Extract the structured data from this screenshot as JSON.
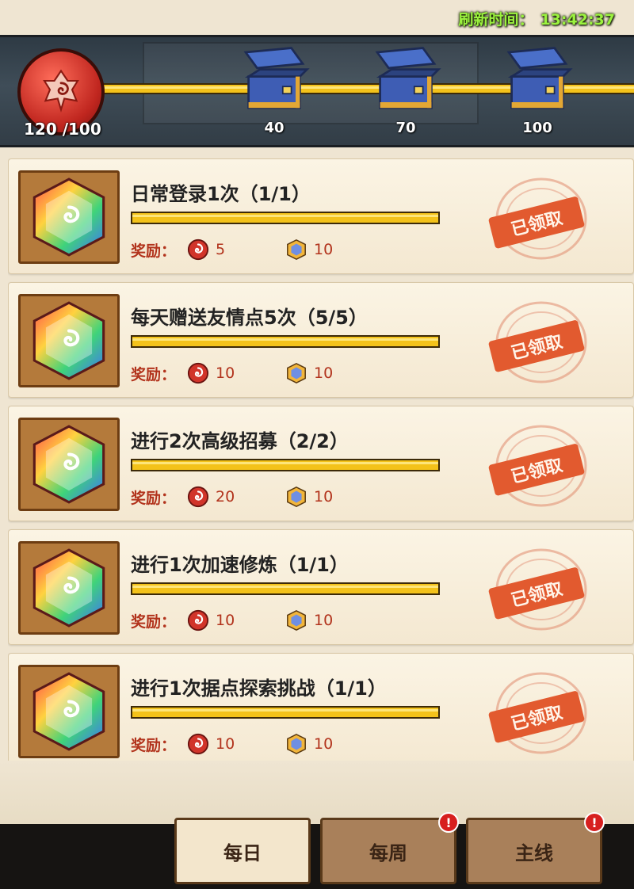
{
  "header": {
    "refresh_label": "刷新时间：",
    "refresh_time": "13:42:37"
  },
  "progress": {
    "score_text": "120 /100",
    "current": 120,
    "max": 100,
    "milestones": [
      {
        "label": "40",
        "value": 40,
        "icon": "treasure-chest-icon"
      },
      {
        "label": "70",
        "value": 70,
        "icon": "treasure-chest-icon"
      },
      {
        "label": "100",
        "value": 100,
        "icon": "treasure-chest-icon"
      }
    ],
    "bar_color": "#f3c21a"
  },
  "tasks": [
    {
      "title": "日常登录1次（1/1）",
      "progress": 1.0,
      "reward_label": "奖励：",
      "reward_1_value": "5",
      "reward_2_value": "10",
      "status": "已领取"
    },
    {
      "title": "每天赠送友情点5次（5/5）",
      "progress": 1.0,
      "reward_label": "奖励：",
      "reward_1_value": "10",
      "reward_2_value": "10",
      "status": "已领取"
    },
    {
      "title": "进行2次高级招募（2/2）",
      "progress": 1.0,
      "reward_label": "奖励：",
      "reward_1_value": "20",
      "reward_2_value": "10",
      "status": "已领取"
    },
    {
      "title": "进行1次加速修炼（1/1）",
      "progress": 1.0,
      "reward_label": "奖励：",
      "reward_1_value": "10",
      "reward_2_value": "10",
      "status": "已领取"
    },
    {
      "title": "进行1次据点探索挑战（1/1）",
      "progress": 1.0,
      "reward_label": "奖励：",
      "reward_1_value": "10",
      "reward_2_value": "10",
      "status": "已领取"
    }
  ],
  "nav": {
    "tabs": [
      {
        "label": "每日",
        "active": true,
        "badge": ""
      },
      {
        "label": "每周",
        "active": false,
        "badge": "!"
      },
      {
        "label": "主线",
        "active": false,
        "badge": "!"
      }
    ]
  },
  "colors": {
    "accent_red": "#c0261f",
    "reward_text": "#b2331c",
    "refresh_green": "#9bf23f"
  }
}
